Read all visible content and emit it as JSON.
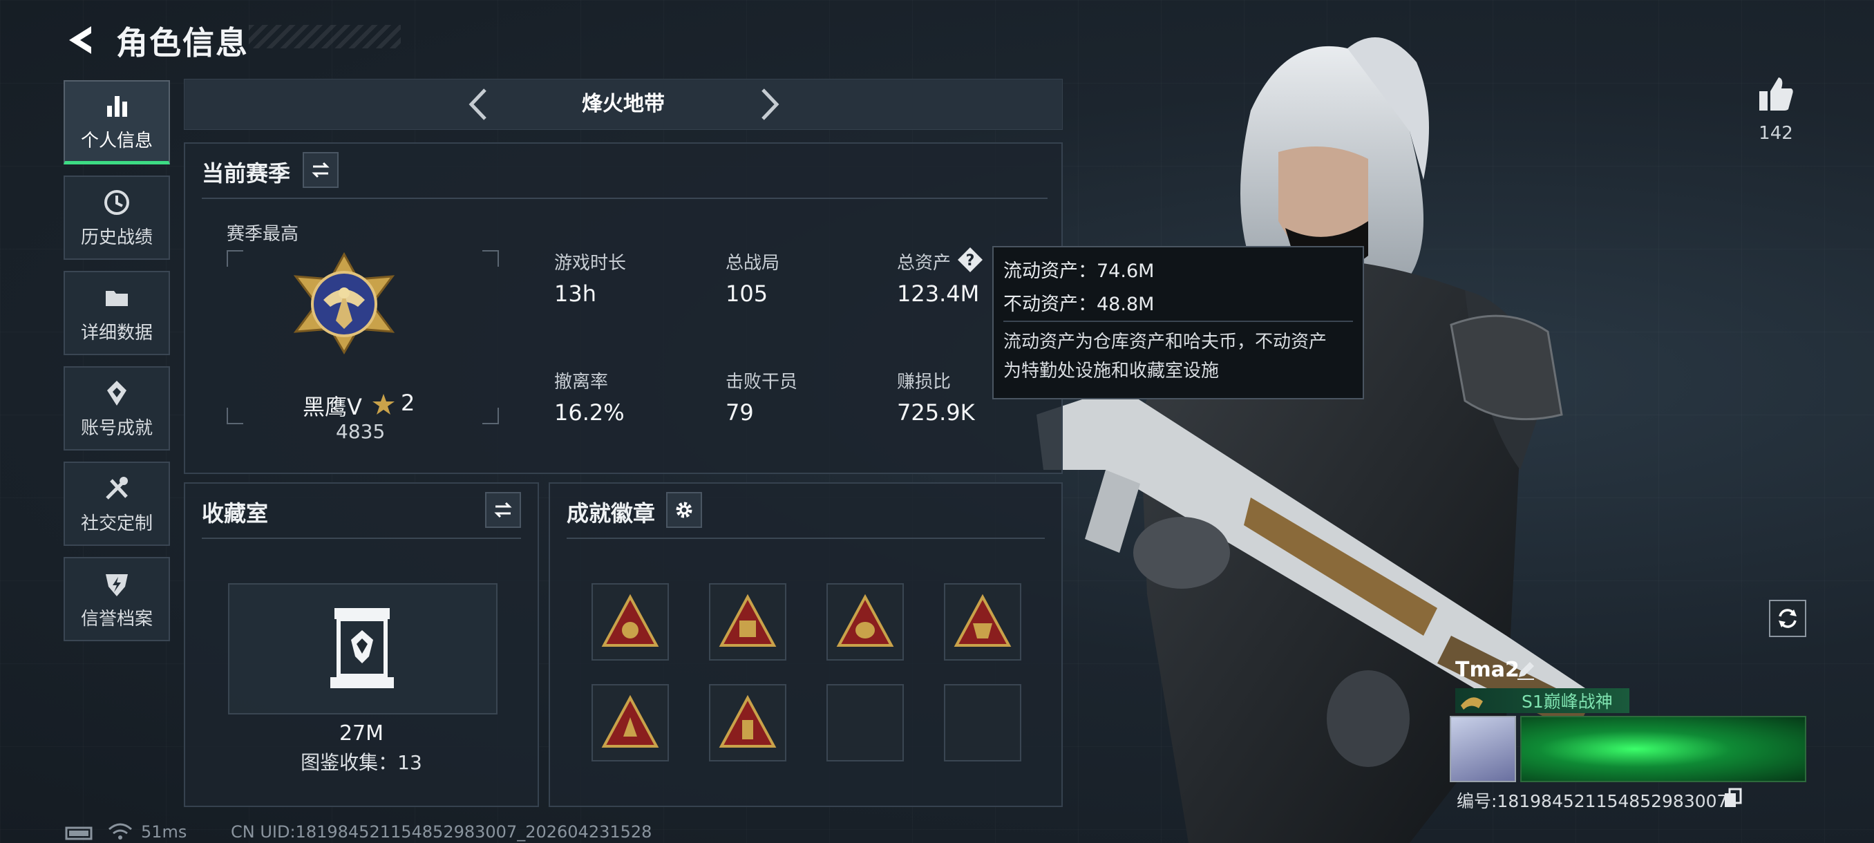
{
  "header": {
    "title": "角色信息"
  },
  "sidebar": {
    "items": [
      {
        "label": "个人信息",
        "icon": "bar-chart-icon",
        "active": true
      },
      {
        "label": "历史战绩",
        "icon": "history-icon"
      },
      {
        "label": "详细数据",
        "icon": "folder-icon"
      },
      {
        "label": "账号成就",
        "icon": "achievement-icon"
      },
      {
        "label": "社交定制",
        "icon": "tools-icon"
      },
      {
        "label": "信誉档案",
        "icon": "shield-icon"
      }
    ]
  },
  "mode": {
    "title": "烽火地带"
  },
  "season": {
    "title": "当前赛季",
    "best_label": "赛季最高",
    "rank_name": "黑鹰Ⅴ",
    "rank_stars": "2",
    "rank_score": "4835",
    "stats": [
      {
        "label": "游戏时长",
        "value": "13h"
      },
      {
        "label": "总战局",
        "value": "105"
      },
      {
        "label": "总资产",
        "value": "123.4M"
      },
      {
        "label": "撤离率",
        "value": "16.2%"
      },
      {
        "label": "击败干员",
        "value": "79"
      },
      {
        "label": "赚损比",
        "value": "725.9K"
      }
    ]
  },
  "tooltip": {
    "liquid": "流动资产：74.6M",
    "fixed": "不动资产：48.8M",
    "desc_line1": "流动资产为仓库资产和哈夫币，不动资产",
    "desc_line2": "为特勤处设施和收藏室设施"
  },
  "collection": {
    "title": "收藏室",
    "value": "27M",
    "catalog": "图鉴收集：13"
  },
  "badges": {
    "title": "成就徽章",
    "slots": 8,
    "filled": 6
  },
  "likes": {
    "count": "142"
  },
  "player": {
    "name": "Tma2",
    "title": "S1巅峰战神",
    "id": "编号:1819845211548529830​07"
  },
  "footer": {
    "ping": "51ms",
    "uid": "CN UID:1819845211548529830​07_202604231528"
  },
  "colors": {
    "accent": "#3ddc84",
    "gold": "#c9a24a",
    "badge_red": "#8a1e1e"
  }
}
